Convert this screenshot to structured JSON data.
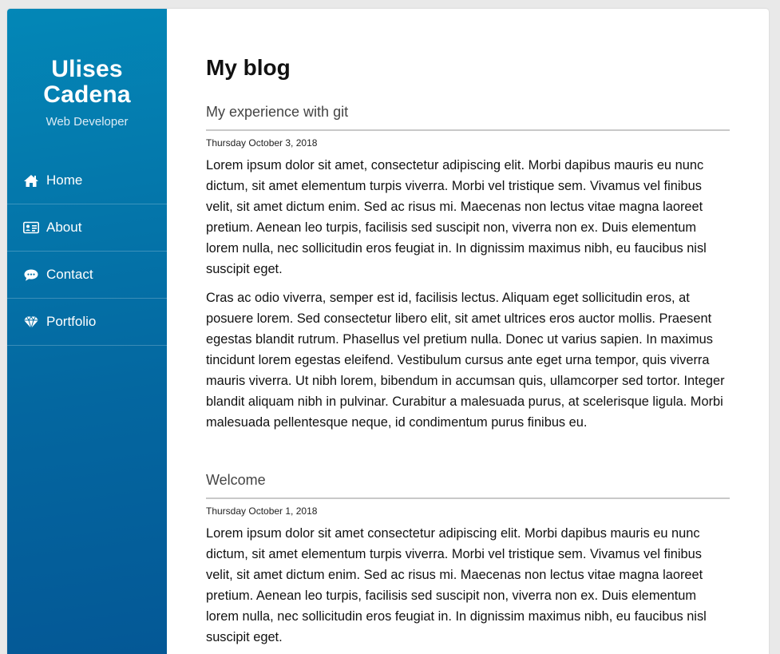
{
  "sidebar": {
    "brand_name": "Ulises\nCadena",
    "brand_role": "Web Developer",
    "items": [
      {
        "label": "Home",
        "icon": "home-icon"
      },
      {
        "label": "About",
        "icon": "id-card-icon"
      },
      {
        "label": "Contact",
        "icon": "chat-bubble-icon"
      },
      {
        "label": "Portfolio",
        "icon": "diamond-icon"
      }
    ]
  },
  "main": {
    "title": "My blog",
    "posts": [
      {
        "title": "My experience with git",
        "date": "Thursday October 3, 2018",
        "paragraphs": [
          "Lorem ipsum dolor sit amet, consectetur adipiscing elit. Morbi dapibus mauris eu nunc dictum, sit amet elementum turpis viverra. Morbi vel tristique sem. Vivamus vel finibus velit, sit amet dictum enim. Sed ac risus mi. Maecenas non lectus vitae magna laoreet pretium. Aenean leo turpis, facilisis sed suscipit non, viverra non ex. Duis elementum lorem nulla, nec sollicitudin eros feugiat in. In dignissim maximus nibh, eu faucibus nisl suscipit eget.",
          "Cras ac odio viverra, semper est id, facilisis lectus. Aliquam eget sollicitudin eros, at posuere lorem. Sed consectetur libero elit, sit amet ultrices eros auctor mollis. Praesent egestas blandit rutrum. Phasellus vel pretium nulla. Donec ut varius sapien. In maximus tincidunt lorem egestas eleifend. Vestibulum cursus ante eget urna tempor, quis viverra mauris viverra. Ut nibh lorem, bibendum in accumsan quis, ullamcorper sed tortor. Integer blandit aliquam nibh in pulvinar. Curabitur a malesuada purus, at scelerisque ligula. Morbi malesuada pellentesque neque, id condimentum purus finibus eu."
        ]
      },
      {
        "title": "Welcome",
        "date": "Thursday October 1, 2018",
        "paragraphs": [
          "Lorem ipsum dolor sit amet consectetur adipiscing elit. Morbi dapibus mauris eu nunc dictum, sit amet elementum turpis viverra. Morbi vel tristique sem. Vivamus vel finibus velit, sit amet dictum enim. Sed ac risus mi. Maecenas non lectus vitae magna laoreet pretium. Aenean leo turpis, facilisis sed suscipit non, viverra non ex. Duis elementum lorem nulla, nec sollicitudin eros feugiat in. In dignissim maximus nibh, eu faucibus nisl suscipit eget."
        ]
      }
    ]
  },
  "colors": {
    "sidebar_top": "#0387b7",
    "sidebar_bottom": "#045896",
    "background": "#e9e9e9"
  }
}
